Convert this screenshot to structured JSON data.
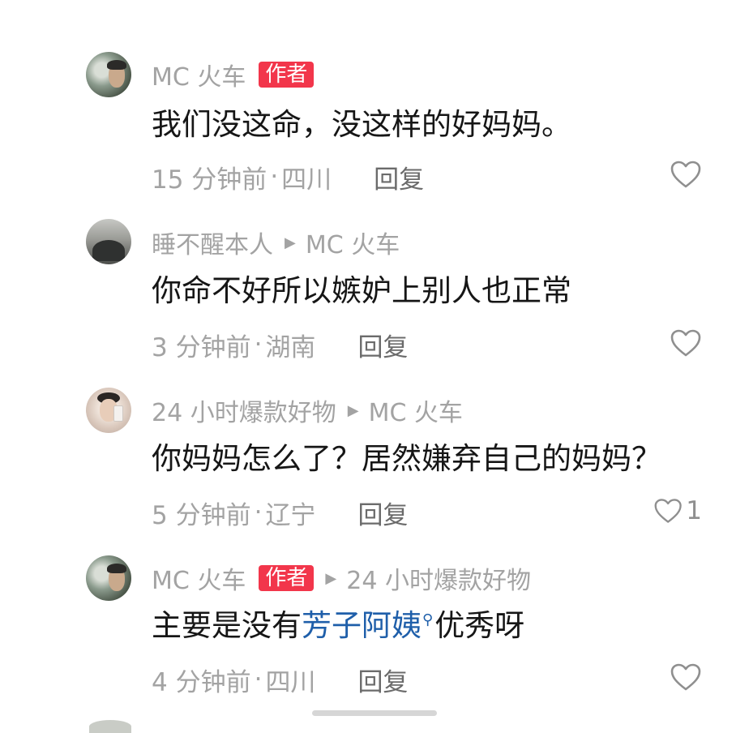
{
  "comments": [
    {
      "author": "MC 火车",
      "badge": "作者",
      "reply_to": "",
      "text": "我们没这命，没这样的好妈妈。",
      "time": "15 分钟前",
      "location": "四川",
      "reply_label": "回复",
      "likes": ""
    },
    {
      "author": "睡不醒本人",
      "badge": "",
      "reply_to": "MC 火车",
      "text": "你命不好所以嫉妒上别人也正常",
      "time": "3 分钟前",
      "location": "湖南",
      "reply_label": "回复",
      "likes": ""
    },
    {
      "author": "24 小时爆款好物",
      "badge": "",
      "reply_to": "MC 火车",
      "text": "你妈妈怎么了？居然嫌弃自己的妈妈？",
      "time": "5 分钟前",
      "location": "辽宁",
      "reply_label": "回复",
      "likes": "1"
    },
    {
      "author": "MC 火车",
      "badge": "作者",
      "reply_to": "24 小时爆款好物",
      "text_before": "主要是没有",
      "text_link": "芳子阿姨",
      "text_after": "优秀呀",
      "time": "4 分钟前",
      "location": "四川",
      "reply_label": "回复",
      "likes": ""
    }
  ],
  "separator": "·",
  "icons": {
    "like": "heart-outline-icon",
    "reply_arrow": "triangle-right-icon",
    "search": "search-icon"
  },
  "colors": {
    "badge_bg": "#f2364b",
    "link": "#1f5faa",
    "meta": "#a3a3a3"
  }
}
